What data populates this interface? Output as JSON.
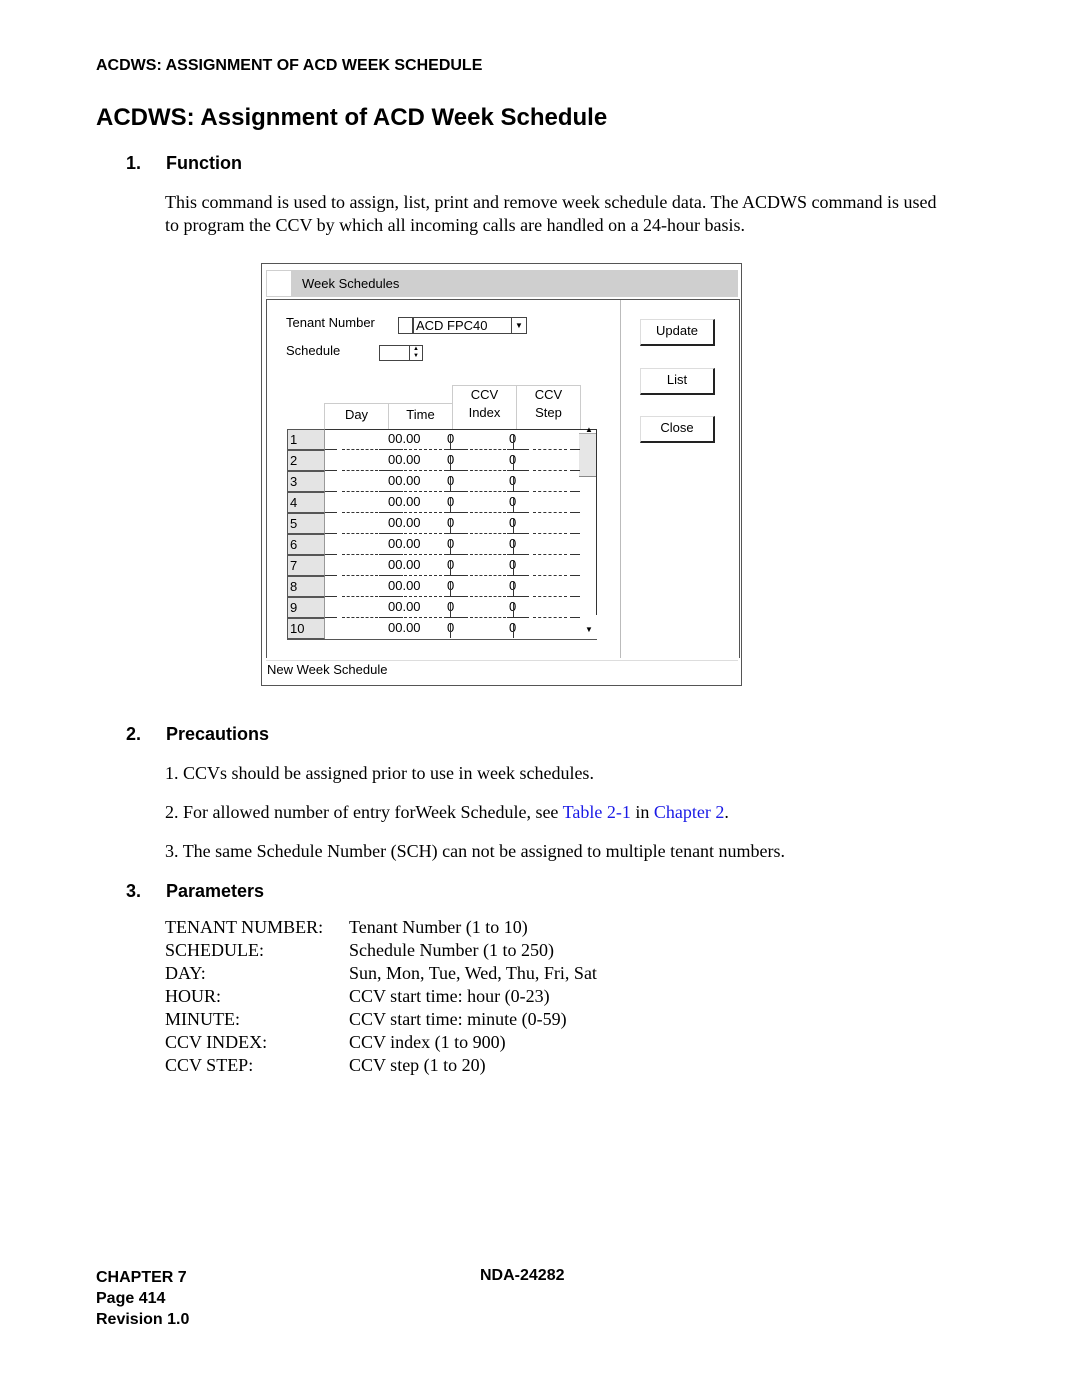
{
  "header": {
    "running_head": "ACDWS: ASSIGNMENT OF ACD WEEK SCHEDULE",
    "title": "ACDWS: Assignment of ACD Week Schedule"
  },
  "sections": {
    "function": {
      "number": "1.",
      "heading": "Function",
      "text_line1": "This command is used to assign, list, print and remove week schedule data. The ACDWS command is used",
      "text_line2": "to program the CCV by which all incoming calls are handled on a 24-hour basis."
    },
    "precautions": {
      "number": "2.",
      "heading": "Precautions",
      "items": [
        {
          "num": "1.",
          "text": "CCVs should be assigned prior to use in week schedules."
        },
        {
          "num": "2.",
          "text_before": "For allowed number of entry forWeek Schedule, see ",
          "link1": "Table 2-1",
          "text_mid": " in ",
          "link2": "Chapter 2",
          "text_after": "."
        },
        {
          "num": "3.",
          "text": "The same Schedule Number (SCH) can not be assigned to multiple tenant numbers."
        }
      ]
    },
    "parameters": {
      "number": "3.",
      "heading": "Parameters",
      "rows": [
        {
          "key": "TENANT NUMBER:",
          "value": "Tenant Number (1 to 10)"
        },
        {
          "key": "SCHEDULE:",
          "value": "Schedule Number (1 to 250)"
        },
        {
          "key": "DAY:",
          "value": "Sun, Mon, Tue, Wed, Thu, Fri, Sat"
        },
        {
          "key": "HOUR:",
          "value": "CCV start time: hour (0-23)"
        },
        {
          "key": "MINUTE:",
          "value": "CCV start time: minute (0-59)"
        },
        {
          "key": "CCV INDEX:",
          "value": "CCV index (1 to 900)"
        },
        {
          "key": "CCV STEP:",
          "value": "CCV step (1 to 20)"
        }
      ]
    }
  },
  "dialog": {
    "title": "Week Schedules",
    "tenant_label": "Tenant Number",
    "tenant_value": "ACD FPC40",
    "schedule_label": "Schedule",
    "schedule_value": "",
    "buttons": {
      "update": "Update",
      "list": "List",
      "close": "Close"
    },
    "columns": {
      "day": "Day",
      "time": "Time",
      "ccv_index_1": "CCV",
      "ccv_index_2": "Index",
      "ccv_step_1": "CCV",
      "ccv_step_2": "Step"
    },
    "rows": [
      {
        "n": "1",
        "day": "",
        "time": "00.00",
        "index": "0",
        "step": "0"
      },
      {
        "n": "2",
        "day": "",
        "time": "00.00",
        "index": "0",
        "step": "0"
      },
      {
        "n": "3",
        "day": "",
        "time": "00.00",
        "index": "0",
        "step": "0"
      },
      {
        "n": "4",
        "day": "",
        "time": "00.00",
        "index": "0",
        "step": "0"
      },
      {
        "n": "5",
        "day": "",
        "time": "00.00",
        "index": "0",
        "step": "0"
      },
      {
        "n": "6",
        "day": "",
        "time": "00.00",
        "index": "0",
        "step": "0"
      },
      {
        "n": "7",
        "day": "",
        "time": "00.00",
        "index": "0",
        "step": "0"
      },
      {
        "n": "8",
        "day": "",
        "time": "00.00",
        "index": "0",
        "step": "0"
      },
      {
        "n": "9",
        "day": "",
        "time": "00.00",
        "index": "0",
        "step": "0"
      },
      {
        "n": "10",
        "day": "",
        "time": "00.00",
        "index": "0",
        "step": "0"
      }
    ],
    "status": "New Week Schedule",
    "icons": {
      "dropdown": "chevron-down-icon",
      "spinner": "spin-up-down-icon",
      "scroll_up": "scroll-up-arrow",
      "scroll_down": "scroll-down-arrow"
    }
  },
  "footer": {
    "chapter": "CHAPTER 7",
    "page": "Page 414",
    "revision": "Revision 1.0",
    "doc_id": "NDA-24282"
  }
}
